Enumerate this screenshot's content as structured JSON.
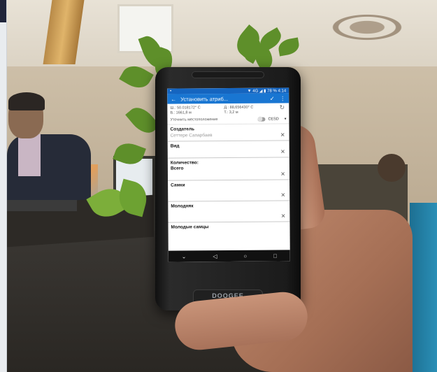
{
  "phone": {
    "brand": "DOOGEE",
    "status": {
      "left": "•",
      "right": "▼ 4G ◢ ▮ 78 % 4:14"
    },
    "appbar": {
      "title": "Установить атриб...",
      "back_icon": "arrow-left-icon",
      "check_icon": "check-icon",
      "more_icon": "more-vertical-icon"
    },
    "coords": {
      "lat": "Ш.: 50.018172° С",
      "lon": "В.: 1661,8 м",
      "accuracy": "Д.: 88,656430° С",
      "time": "Т.: 3,2 м"
    },
    "location": {
      "label": "Уточнить местоположение",
      "crs": "СЕSD"
    },
    "fields": [
      {
        "label": "Создатель",
        "value": "Сеттере Сапарбаев"
      },
      {
        "label": "Вид",
        "value": ""
      },
      {
        "label": "Количество:",
        "value": "Всего"
      },
      {
        "label": "Самки",
        "value": ""
      },
      {
        "label": "Молодняк",
        "value": ""
      },
      {
        "label": "Молодые самцы",
        "value": ""
      }
    ],
    "navbar": {
      "down": "⌄",
      "back": "◁",
      "home": "○",
      "recent": "□"
    }
  },
  "colors": {
    "appbar": "#1976d2",
    "statusbar": "#1565c0",
    "sleeve": "#1d6f92"
  }
}
